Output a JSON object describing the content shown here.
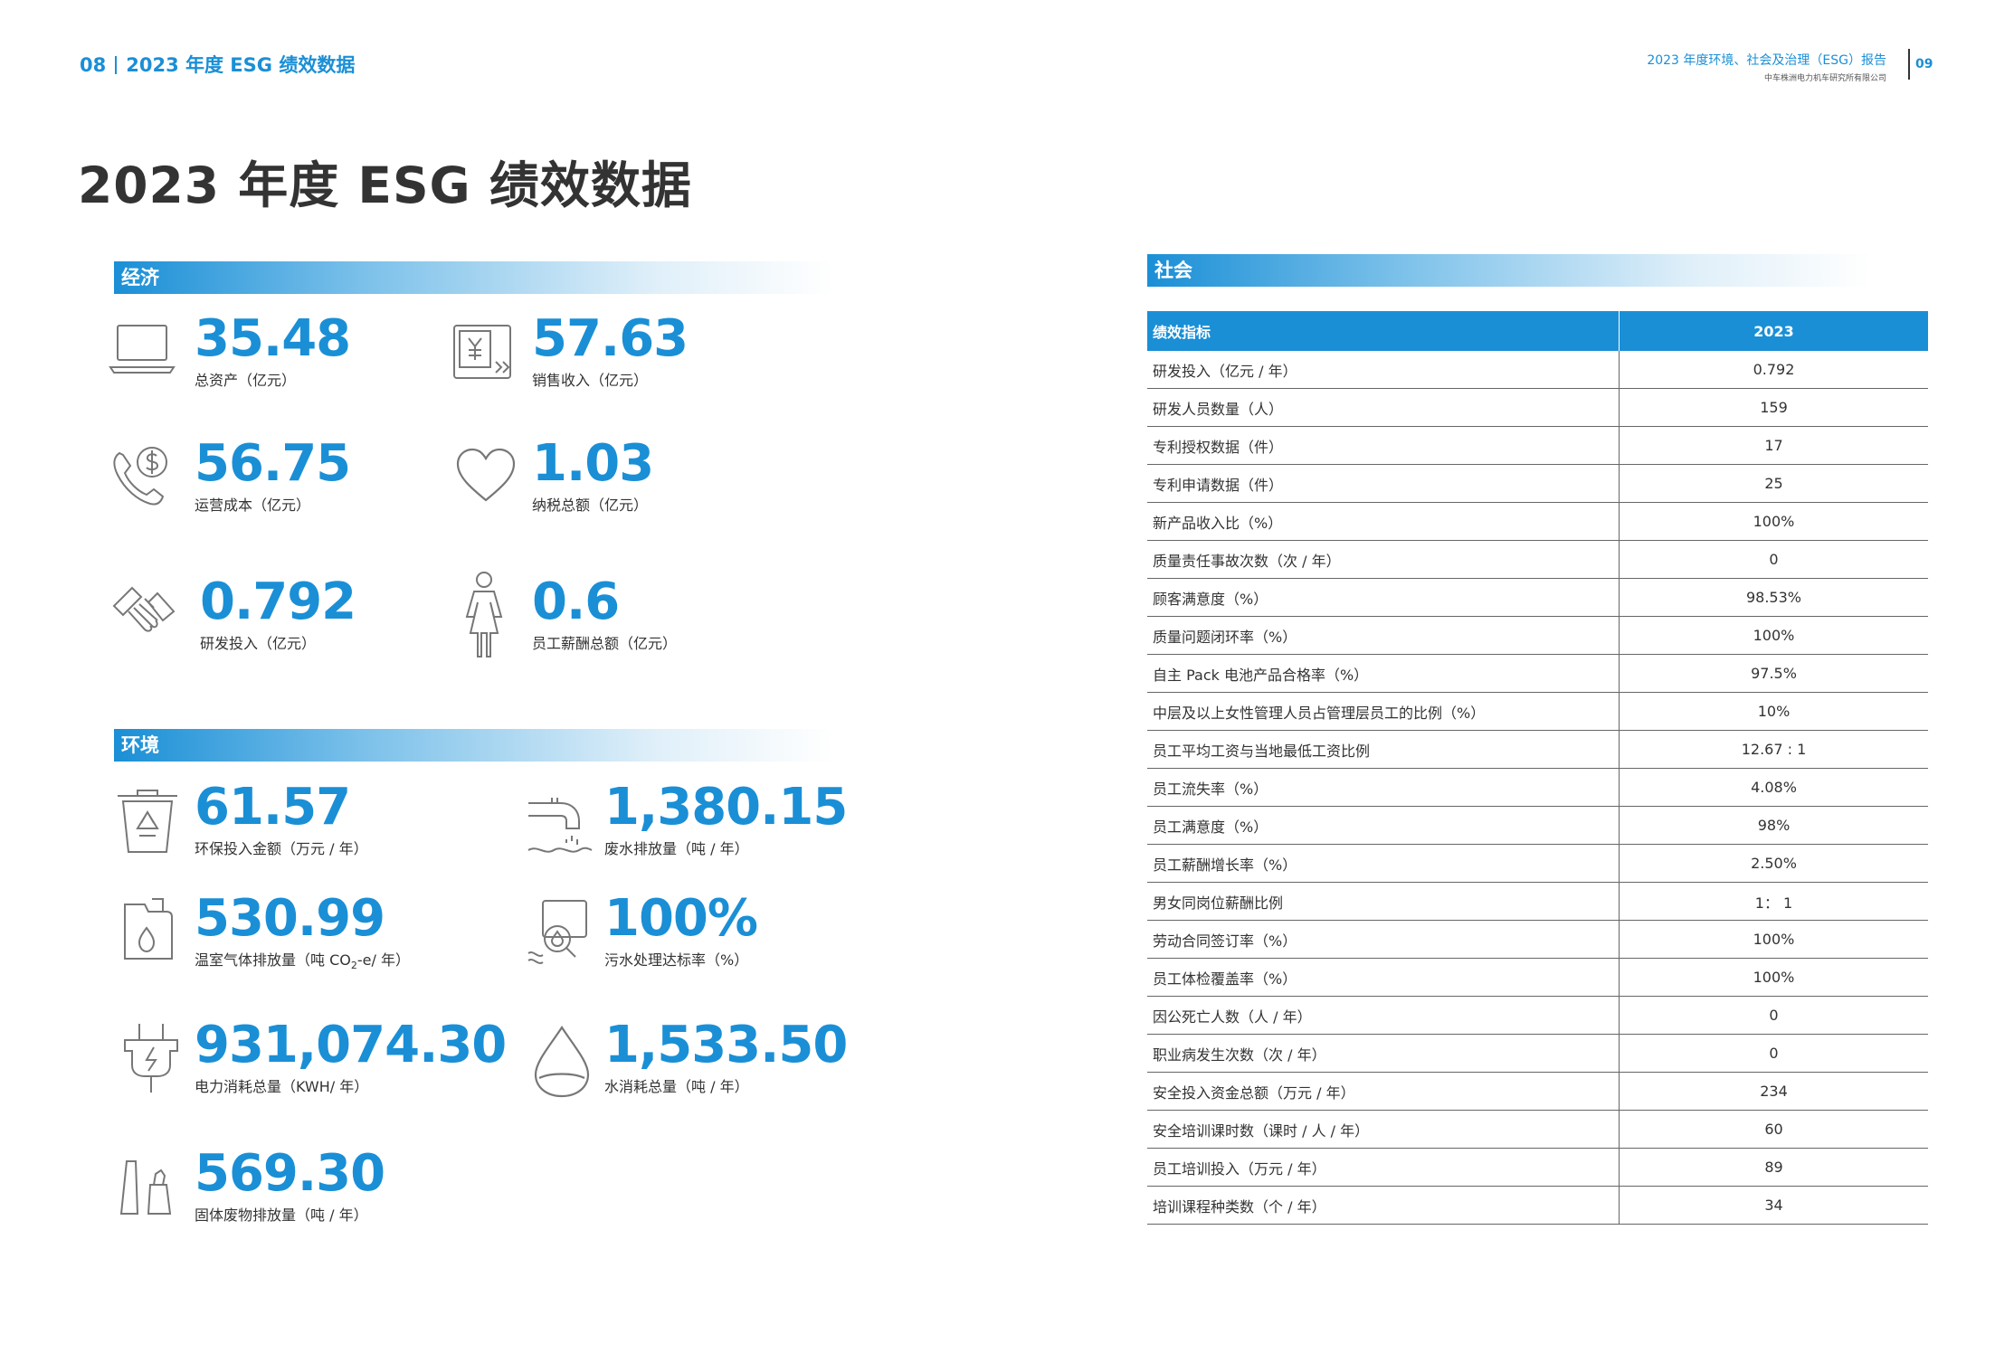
{
  "header": {
    "left_page": "08",
    "left_title": "2023 年度 ESG 绩效数据",
    "right_title": "2023 年度环境、社会及治理（ESG）报告",
    "right_subtitle": "中车株洲电力机车研究所有限公司",
    "right_page": "09"
  },
  "main_title": "2023 年度 ESG 绩效数据",
  "economy": {
    "section_label": "经济",
    "metrics": [
      {
        "value": "35.48",
        "label": "总资产（亿元）",
        "icon": "laptop-icon"
      },
      {
        "value": "57.63",
        "label": "销售收入（亿元）",
        "icon": "yuan-screen-icon"
      },
      {
        "value": "56.75",
        "label": "运营成本（亿元）",
        "icon": "phone-dollar-icon"
      },
      {
        "value": "1.03",
        "label": "纳税总额（亿元）",
        "icon": "heart-icon"
      },
      {
        "value": "0.792",
        "label": "研发投入（亿元）",
        "icon": "handshake-icon"
      },
      {
        "value": "0.6",
        "label": "员工薪酬总额（亿元）",
        "icon": "person-icon"
      }
    ]
  },
  "environment": {
    "section_label": "环境",
    "metrics": [
      {
        "value": "61.57",
        "label": "环保投入金额（万元 / 年）",
        "icon": "recycle-bin-icon"
      },
      {
        "value": "1,380.15",
        "label": "废水排放量（吨 / 年）",
        "icon": "waste-water-pipe-icon"
      },
      {
        "value": "530.99",
        "label_pre": "温室气体排放量（吨 CO",
        "label_sub": "2",
        "label_post": "-e/ 年）",
        "icon": "fuel-canister-icon"
      },
      {
        "value": "100%",
        "label": "污水处理达标率（%）",
        "icon": "water-inspect-icon"
      },
      {
        "value": "931,074.30",
        "label": "电力消耗总量（KWH/ 年）",
        "icon": "power-plug-icon"
      },
      {
        "value": "1,533.50",
        "label": "水消耗总量（吨 / 年）",
        "icon": "water-drop-icon"
      },
      {
        "value": "569.30",
        "label": "固体废物排放量（吨 / 年）",
        "icon": "solid-waste-icon"
      }
    ]
  },
  "society": {
    "section_label": "社会",
    "table_headers": [
      "绩效指标",
      "2023"
    ],
    "rows": [
      [
        "研发投入（亿元 / 年）",
        "0.792"
      ],
      [
        "研发人员数量（人）",
        "159"
      ],
      [
        "专利授权数据（件）",
        "17"
      ],
      [
        "专利申请数据（件）",
        "25"
      ],
      [
        "新产品收入比（%）",
        "100%"
      ],
      [
        "质量责任事故次数（次 / 年）",
        "0"
      ],
      [
        "顾客满意度（%）",
        "98.53%"
      ],
      [
        "质量问题闭环率（%）",
        "100%"
      ],
      [
        "自主 Pack 电池产品合格率（%）",
        "97.5%"
      ],
      [
        "中层及以上女性管理人员占管理层员工的比例（%）",
        "10%"
      ],
      [
        "员工平均工资与当地最低工资比例",
        "12.67 : 1"
      ],
      [
        "员工流失率（%）",
        "4.08%"
      ],
      [
        "员工满意度（%）",
        "98%"
      ],
      [
        "员工薪酬增长率（%）",
        "2.50%"
      ],
      [
        "男女同岗位薪酬比例",
        "1： 1"
      ],
      [
        "劳动合同签订率（%）",
        "100%"
      ],
      [
        "员工体检覆盖率（%）",
        "100%"
      ],
      [
        "因公死亡人数（人 / 年）",
        "0"
      ],
      [
        "职业病发生次数（次 / 年）",
        "0"
      ],
      [
        "安全投入资金总额（万元 / 年）",
        "234"
      ],
      [
        "安全培训课时数（课时 / 人 / 年）",
        "60"
      ],
      [
        "员工培训投入（万元 / 年）",
        "89"
      ],
      [
        "培训课程种类数（个 / 年）",
        "34"
      ]
    ]
  },
  "colors": {
    "accent": "#1a8fd6",
    "text": "#333333",
    "icon": "#777777"
  }
}
